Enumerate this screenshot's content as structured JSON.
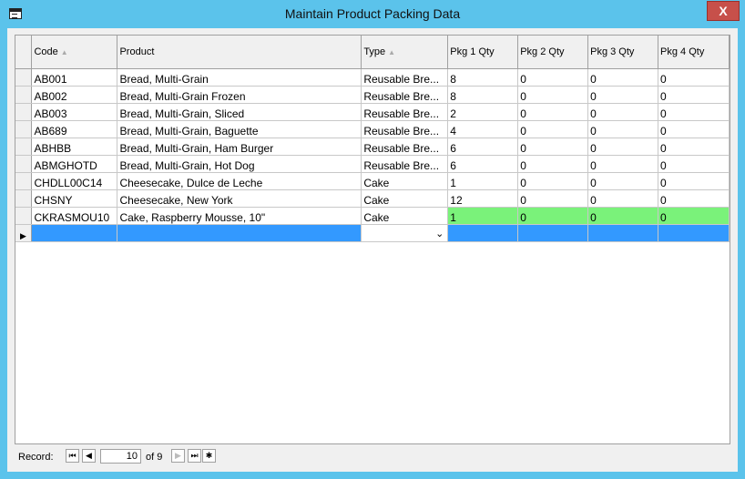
{
  "window": {
    "title": "Maintain Product Packing Data",
    "close_glyph": "X"
  },
  "grid": {
    "columns": [
      {
        "label": "Code",
        "sort_icon": "sort-indicator-icon"
      },
      {
        "label": "Product",
        "sort_icon": ""
      },
      {
        "label": "Type",
        "sort_icon": "sort-indicator-icon"
      },
      {
        "label": "Pkg 1 Qty",
        "sort_icon": ""
      },
      {
        "label": "Pkg 2 Qty",
        "sort_icon": ""
      },
      {
        "label": "Pkg 3 Qty",
        "sort_icon": ""
      },
      {
        "label": "Pkg 4 Qty",
        "sort_icon": ""
      }
    ],
    "rows": [
      [
        "AB001",
        "Bread, Multi-Grain",
        "Reusable Bre...",
        "8",
        "0",
        "0",
        "0"
      ],
      [
        "AB002",
        "Bread, Multi-Grain Frozen",
        "Reusable Bre...",
        "8",
        "0",
        "0",
        "0"
      ],
      [
        "AB003",
        "Bread, Multi-Grain, Sliced",
        "Reusable Bre...",
        "2",
        "0",
        "0",
        "0"
      ],
      [
        "AB689",
        "Bread, Multi-Grain, Baguette",
        "Reusable Bre...",
        "4",
        "0",
        "0",
        "0"
      ],
      [
        "ABHBB",
        "Bread, Multi-Grain, Ham Burger",
        "Reusable Bre...",
        "6",
        "0",
        "0",
        "0"
      ],
      [
        "ABMGHOTD",
        "Bread, Multi-Grain, Hot Dog",
        "Reusable Bre...",
        "6",
        "0",
        "0",
        "0"
      ],
      [
        "CHDLL00C14",
        "Cheesecake, Dulce de Leche",
        "Cake",
        "1",
        "0",
        "0",
        "0"
      ],
      [
        "CHSNY",
        "Cheesecake, New York",
        "Cake",
        "12",
        "0",
        "0",
        "0"
      ],
      [
        "CKRASMOU10",
        "Cake, Raspberry Mousse, 10\"",
        "Cake",
        "1",
        "0",
        "0",
        "0"
      ]
    ],
    "highlight_color": "#7af27a",
    "new_row_color": "#3399ff"
  },
  "navigator": {
    "label": "Record:",
    "current": "10",
    "of_text": "of 9",
    "icons": [
      "first-record-icon",
      "previous-record-icon",
      "next-record-icon",
      "last-record-icon",
      "new-record-icon"
    ]
  }
}
